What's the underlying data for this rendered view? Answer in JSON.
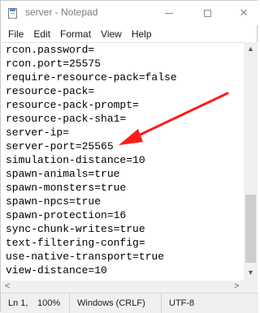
{
  "window": {
    "title": "server - Notepad",
    "minimize_glyph": "",
    "close_glyph": "✕"
  },
  "menu": {
    "items": [
      {
        "label": "File"
      },
      {
        "label": "Edit"
      },
      {
        "label": "Format"
      },
      {
        "label": "View"
      },
      {
        "label": "Help"
      }
    ]
  },
  "editor": {
    "lines": [
      "rcon.password=",
      "rcon.port=25575",
      "require-resource-pack=false",
      "resource-pack=",
      "resource-pack-prompt=",
      "resource-pack-sha1=",
      "server-ip=",
      "server-port=25565",
      "simulation-distance=10",
      "spawn-animals=true",
      "spawn-monsters=true",
      "spawn-npcs=true",
      "spawn-protection=16",
      "sync-chunk-writes=true",
      "text-filtering-config=",
      "use-native-transport=true",
      "view-distance=10"
    ]
  },
  "scrollbars": {
    "up_glyph": "▲",
    "down_glyph": "▼",
    "left_glyph": "<",
    "right_glyph": ">"
  },
  "status": {
    "position": "Ln 1,",
    "zoom": "100%",
    "line_endings": "Windows (CRLF)",
    "encoding": "UTF-8"
  },
  "annotation": {
    "color": "#ff1a1a",
    "points_to": "server-port=25565"
  }
}
